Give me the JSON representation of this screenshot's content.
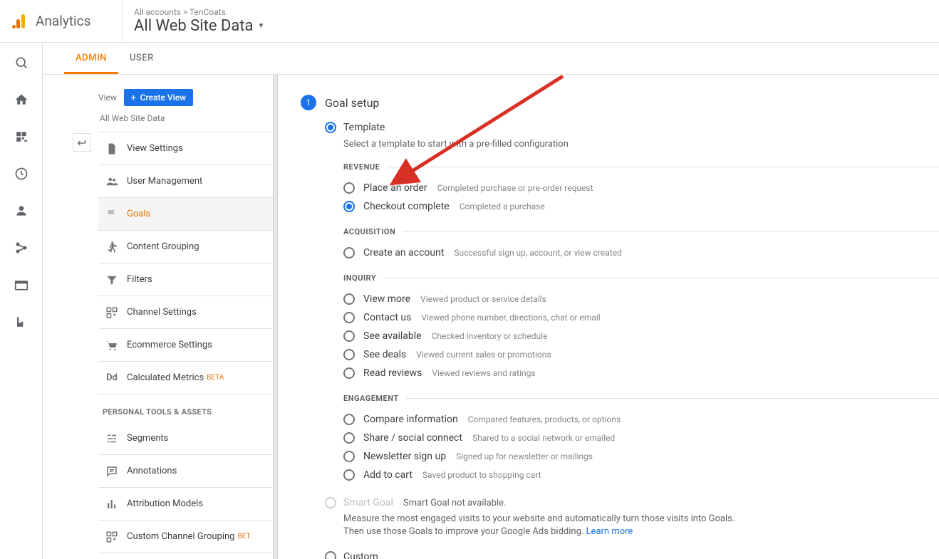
{
  "header": {
    "product_name": "Analytics",
    "breadcrumb": "All accounts > TenCoats",
    "view_name": "All Web Site Data"
  },
  "tabs": {
    "admin": "ADMIN",
    "user": "USER"
  },
  "view_column": {
    "label": "View",
    "create_button": "Create View",
    "current_view": "All Web Site Data",
    "items": [
      {
        "label": "View Settings",
        "icon": "file-icon"
      },
      {
        "label": "User Management",
        "icon": "people-icon"
      },
      {
        "label": "Goals",
        "icon": "flag-icon",
        "active": true
      },
      {
        "label": "Content Grouping",
        "icon": "person-walk-icon"
      },
      {
        "label": "Filters",
        "icon": "filter-icon"
      },
      {
        "label": "Channel Settings",
        "icon": "channels-icon"
      },
      {
        "label": "Ecommerce Settings",
        "icon": "cart-icon"
      },
      {
        "label": "Calculated Metrics",
        "icon": "dd-icon",
        "beta": "BETA"
      }
    ],
    "tools_header": "PERSONAL TOOLS & ASSETS",
    "tools": [
      {
        "label": "Segments",
        "icon": "segments-icon"
      },
      {
        "label": "Annotations",
        "icon": "chat-icon"
      },
      {
        "label": "Attribution Models",
        "icon": "bars-icon"
      },
      {
        "label": "Custom Channel Grouping",
        "icon": "channels-icon",
        "beta": "BET."
      }
    ]
  },
  "goal_setup": {
    "step_number": "1",
    "step_title": "Goal setup",
    "option_template": "Template",
    "tpl_subtitle": "Select a template to start with a pre-filled configuration",
    "sections": [
      {
        "title": "REVENUE",
        "options": [
          {
            "name": "Place an order",
            "desc": "Completed purchase or pre-order request",
            "selected": false
          },
          {
            "name": "Checkout complete",
            "desc": "Completed a purchase",
            "selected": true
          }
        ]
      },
      {
        "title": "ACQUISITION",
        "options": [
          {
            "name": "Create an account",
            "desc": "Successful sign up, account, or view created",
            "selected": false
          }
        ]
      },
      {
        "title": "INQUIRY",
        "options": [
          {
            "name": "View more",
            "desc": "Viewed product or service details",
            "selected": false
          },
          {
            "name": "Contact us",
            "desc": "Viewed phone number, directions, chat or email",
            "selected": false
          },
          {
            "name": "See available",
            "desc": "Checked inventory or schedule",
            "selected": false
          },
          {
            "name": "See deals",
            "desc": "Viewed current sales or promotions",
            "selected": false
          },
          {
            "name": "Read reviews",
            "desc": "Viewed reviews and ratings",
            "selected": false
          }
        ]
      },
      {
        "title": "ENGAGEMENT",
        "options": [
          {
            "name": "Compare information",
            "desc": "Compared features, products, or options",
            "selected": false
          },
          {
            "name": "Share / social connect",
            "desc": "Shared to a social network or emailed",
            "selected": false
          },
          {
            "name": "Newsletter sign up",
            "desc": "Signed up for newsletter or mailings",
            "selected": false
          },
          {
            "name": "Add to cart",
            "desc": "Saved product to shopping cart",
            "selected": false
          }
        ]
      }
    ],
    "smart_goal": {
      "label": "Smart Goal",
      "unavailable": "Smart Goal not available.",
      "desc": "Measure the most engaged visits to your website and automatically turn those visits into Goals. Then use those Goals to improve your Google Ads bidding. ",
      "learn_more": "Learn more"
    },
    "custom_label": "Custom"
  }
}
